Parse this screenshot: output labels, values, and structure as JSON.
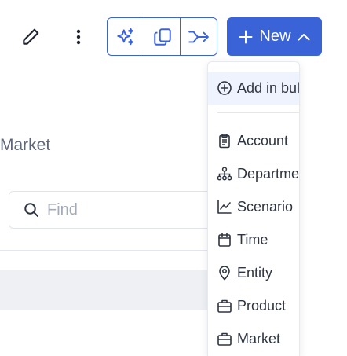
{
  "toolbar": {
    "edit_icon": "pencil-icon",
    "more_icon": "kebab-vertical-icon",
    "group_icons": [
      "sparkles-icon",
      "copy-icon",
      "merge-arrow-icon"
    ],
    "new_label": "New"
  },
  "colors": {
    "accent": "#3b63d8",
    "highlight": "#eef3fd",
    "band": "#eef0f4"
  },
  "main": {
    "title": "Market",
    "find_placeholder": "Find"
  },
  "dropdown": {
    "bulk_label": "Add in bulk",
    "items": [
      {
        "label": "Account",
        "icon": "clipboard-icon"
      },
      {
        "label": "Department",
        "icon": "hierarchy-icon"
      },
      {
        "label": "Scenario",
        "icon": "line-chart-icon"
      },
      {
        "label": "Time",
        "icon": "calendar-icon"
      },
      {
        "label": "Entity",
        "icon": "map-pin-icon"
      },
      {
        "label": "Product",
        "icon": "briefcase-icon"
      },
      {
        "label": "Market",
        "icon": "briefcase-icon"
      }
    ]
  }
}
